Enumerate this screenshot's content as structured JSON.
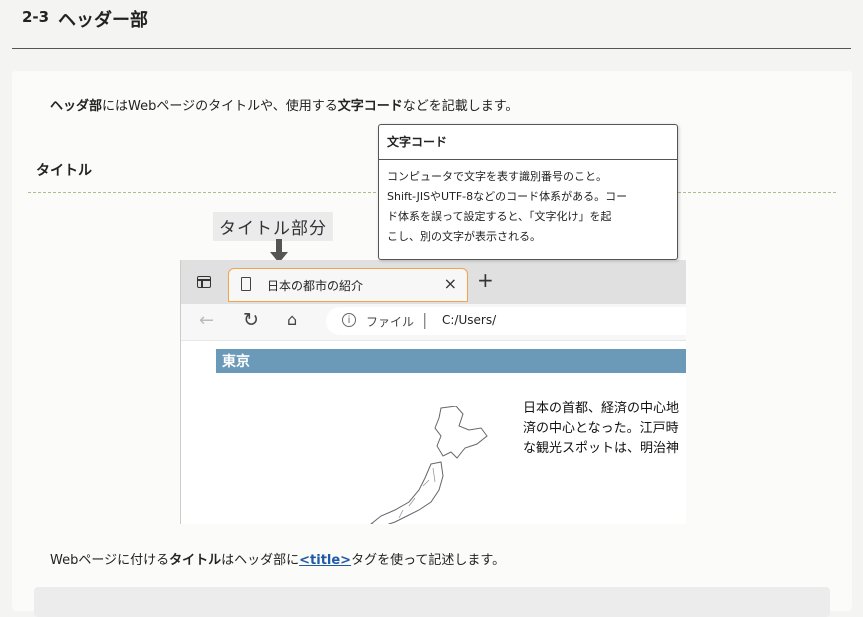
{
  "section": {
    "number": "2-3",
    "title": "ヘッダー部"
  },
  "intro": {
    "part1_bold": "ヘッダ部",
    "part2": "にはWebページのタイトルや、使用する",
    "part3_bold": "文字コード",
    "part4": "などを記載します。"
  },
  "subheading": "タイトル",
  "tooltip": {
    "title": "文字コード",
    "lines": [
      "コンピュータで文字を表す識別番号のこと。",
      "Shift-JISやUTF-8などのコード体系がある。コー",
      "ド体系を誤って設定すると、「文字化け」を起",
      "こし、別の文字が表示される。"
    ]
  },
  "callout": "タイトル部分",
  "browser": {
    "tab_label": "日本の都市の紹介",
    "tab_close": "×",
    "new_tab": "+",
    "address_file": "ファイル",
    "address_sep": "|",
    "address_path": "C:/Users/",
    "info_icon": "i",
    "nav_back": "←",
    "nav_reload": "↻",
    "nav_home": "⌂",
    "page": {
      "city": "東京",
      "text_lines": [
        "日本の首都、経済の中心地",
        "済の中心となった。江戸時",
        "な観光スポットは、明治神"
      ]
    }
  },
  "outro": {
    "part1": "Webページに付ける",
    "part2_bold": "タイトル",
    "part3": "はヘッダ部に",
    "link": "<title>",
    "part4": "タグを使って記述します。"
  },
  "colors": {
    "accent_tab": "#f0a44b",
    "city_bar": "#6b99b8",
    "link": "#1e5aa8",
    "dash": "#a9bf8f"
  }
}
